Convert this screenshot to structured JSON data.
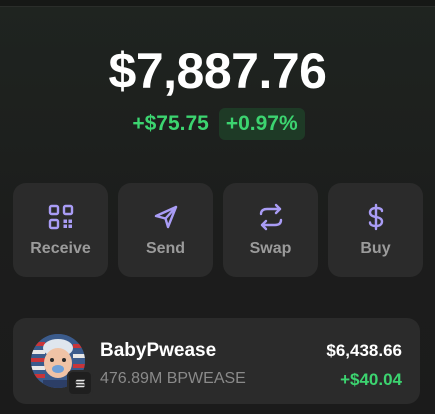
{
  "wallet": {
    "balance": "$7,887.76",
    "change_amount": "+$75.75",
    "change_percent": "+0.97%"
  },
  "actions": [
    {
      "label": "Receive",
      "icon": "qr-code-icon"
    },
    {
      "label": "Send",
      "icon": "send-icon"
    },
    {
      "label": "Swap",
      "icon": "swap-icon"
    },
    {
      "label": "Buy",
      "icon": "dollar-icon"
    }
  ],
  "tokens": [
    {
      "name": "BabyPwease",
      "amount": "476.89M BPWEASE",
      "value": "$6,438.66",
      "change": "+$40.04",
      "chain_icon": "solana-icon"
    }
  ],
  "colors": {
    "accent_purple": "#a99cf5",
    "positive_green": "#3cd470",
    "card_background": "#2b2b2b"
  }
}
